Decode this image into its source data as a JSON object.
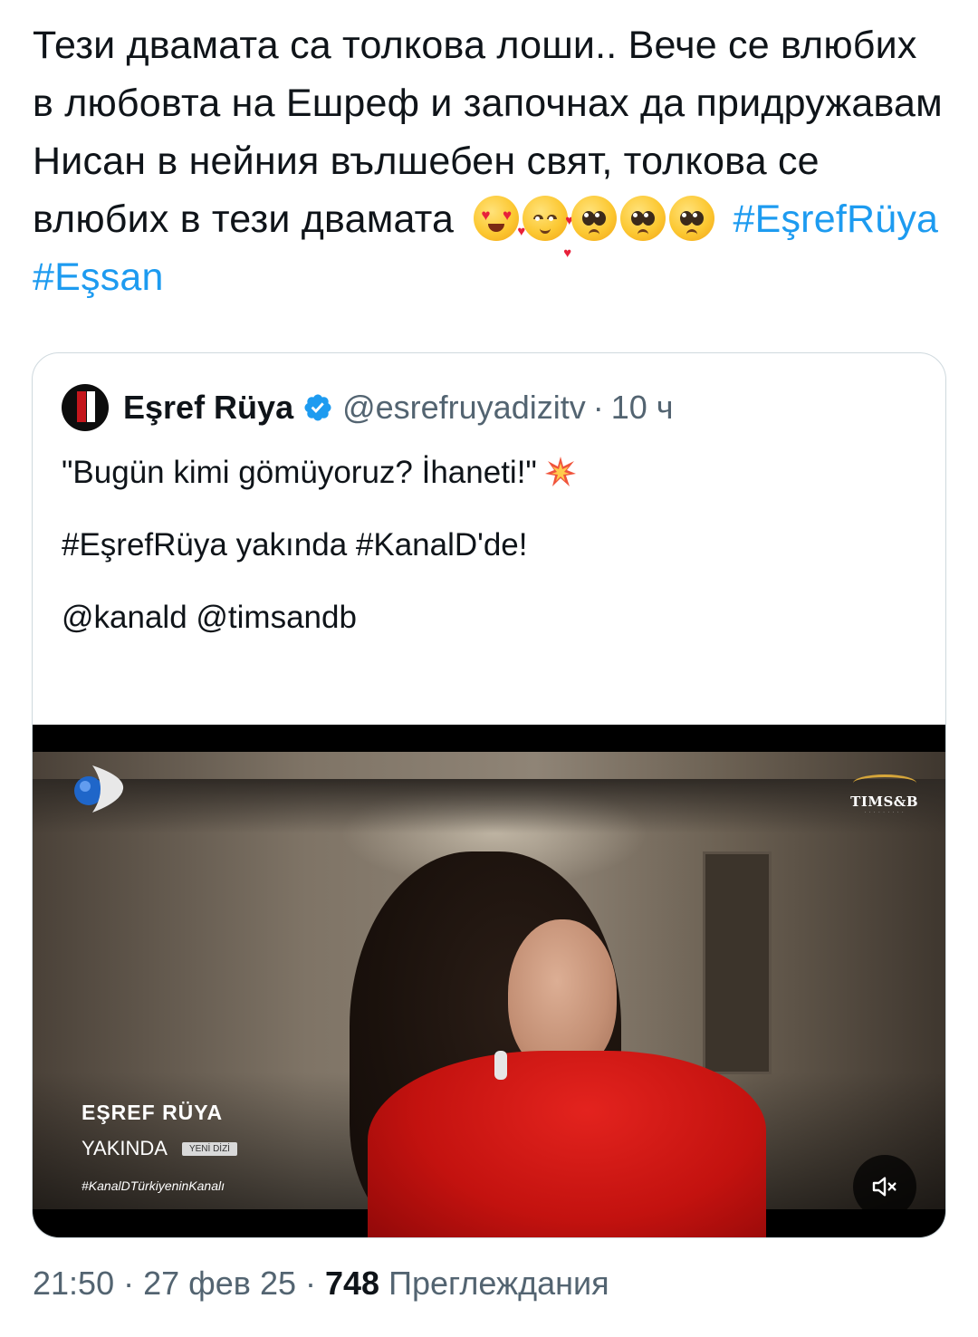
{
  "tweet": {
    "text_part1": "Тези двамата са толкова лоши.. Вече се влюбих в любовта на Ешреф и започнах да придружавам Нисан в нейния вълшебен свят, толкова се влюбих в тези двамата",
    "emojis": [
      "heart-eyes-emoji",
      "smiling-face-with-hearts-emoji",
      "pleading-face-emoji",
      "pleading-face-emoji",
      "pleading-face-emoji"
    ],
    "hashtag1": "#EşrefRüya",
    "hashtag2": "#Eşsan",
    "link_color": "#1d9bf0"
  },
  "quoted": {
    "name": "Eşref Rüya",
    "handle": "@esrefruyadizitv",
    "sep": "·",
    "time": "10 ч",
    "line1": "\"Bugün kimi gömüyoruz? İhaneti!\"",
    "line2": "#EşrefRüya yakında #KanalD'de!",
    "line3": "@kanald @timsandb",
    "verified_color": "#1d9bf0"
  },
  "video": {
    "tims_logo_text": "TIMS&B",
    "overlay_title": "EŞREF RÜYA",
    "overlay_subtitle": "YAKINDA",
    "overlay_badge": "YENİ DİZİ",
    "overlay_hashtag": "#KanalDTürkiyeninKanalı",
    "mute_icon": "speaker-muted-icon"
  },
  "meta": {
    "time": "21:50",
    "sep1": "·",
    "date": "27 фев 25",
    "sep2": "·",
    "views_count": "748",
    "views_label": "Преглеждания"
  }
}
